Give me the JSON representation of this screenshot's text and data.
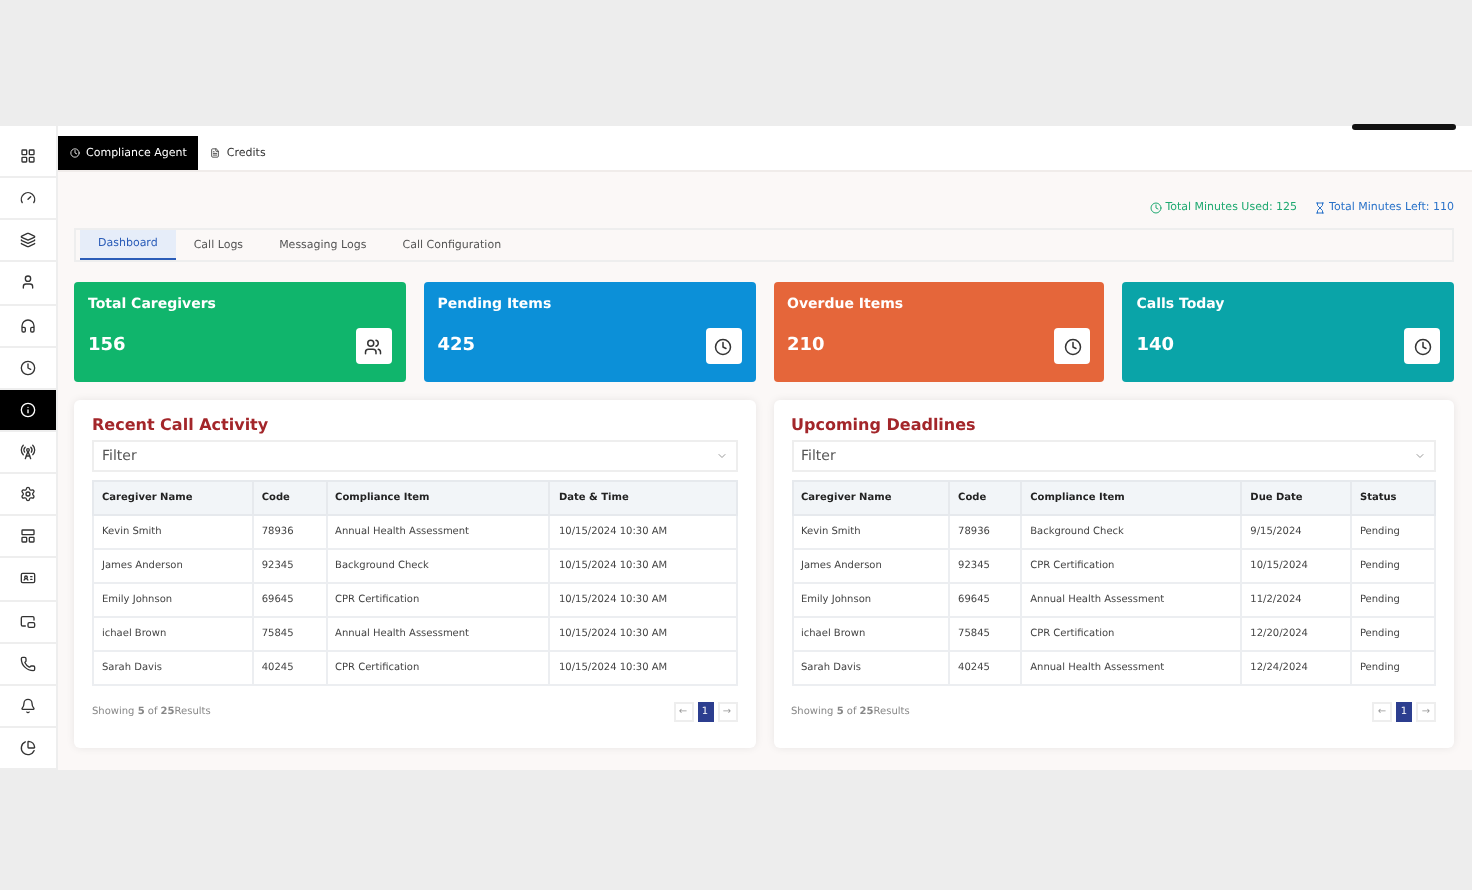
{
  "sidebar": {
    "items": [
      {
        "selected": false
      },
      {
        "selected": false
      },
      {
        "selected": false
      },
      {
        "selected": false
      },
      {
        "selected": false
      },
      {
        "selected": false
      },
      {
        "selected": true
      },
      {
        "selected": false
      },
      {
        "selected": false
      },
      {
        "selected": false
      },
      {
        "selected": false
      },
      {
        "selected": false
      },
      {
        "selected": false
      },
      {
        "selected": false
      },
      {
        "selected": false
      }
    ]
  },
  "top_tabs": [
    {
      "label": "Compliance Agent",
      "selected": true
    },
    {
      "label": "Credits",
      "selected": false
    }
  ],
  "minutes": [
    {
      "label": "Total Minutes Used: 125",
      "color": "#1fa971"
    },
    {
      "label": "Total Minutes Left: 110",
      "color": "#2a73c9"
    }
  ],
  "tabs": [
    {
      "label": "Dashboard",
      "selected": true
    },
    {
      "label": "Call Logs",
      "selected": false
    },
    {
      "label": "Messaging Logs",
      "selected": false
    },
    {
      "label": "Call Configuration",
      "selected": false
    }
  ],
  "cards": [
    {
      "title": "Total Caregivers",
      "value": "156",
      "color": "#10b56c"
    },
    {
      "title": "Pending Items",
      "value": "425",
      "color": "#0c90d8"
    },
    {
      "title": "Overdue Items",
      "value": "210",
      "color": "#e5663a"
    },
    {
      "title": "Calls Today",
      "value": "140",
      "color": "#0aa4a8"
    }
  ],
  "panels": [
    {
      "title": "Recent Call Activity",
      "filter": {
        "placeholder": "Filter"
      },
      "columns": [
        "Caregiver Name",
        "Code",
        "Compliance Item",
        "Date & Time"
      ],
      "rows": [
        [
          "Kevin Smith",
          "78936",
          "Annual Health Assessment",
          "10/15/2024 10:30 AM"
        ],
        [
          "James Anderson",
          "92345",
          "Background Check",
          "10/15/2024 10:30 AM"
        ],
        [
          "Emily Johnson",
          "69645",
          "CPR Certification",
          "10/15/2024 10:30 AM"
        ],
        [
          "ichael Brown",
          "75845",
          "Annual Health Assessment",
          "10/15/2024 10:30 AM"
        ],
        [
          "Sarah Davis",
          "40245",
          "CPR Certification",
          "10/15/2024 10:30 AM"
        ]
      ],
      "footer": "Showing **5** of **25**Results",
      "prev": "←",
      "next": "→",
      "pages": [
        {
          "label": "1",
          "selected": true
        }
      ]
    },
    {
      "title": "Upcoming Deadlines",
      "filter": {
        "placeholder": "Filter"
      },
      "columns": [
        "Caregiver Name",
        "Code",
        "Compliance Item",
        "Due Date",
        "Status"
      ],
      "rows": [
        [
          "Kevin Smith",
          "78936",
          "Background Check",
          "9/15/2024",
          "Pending"
        ],
        [
          "James Anderson",
          "92345",
          "CPR Certification",
          "10/15/2024",
          "Pending"
        ],
        [
          "Emily Johnson",
          "69645",
          "Annual Health Assessment",
          "11/2/2024",
          "Pending"
        ],
        [
          "ichael Brown",
          "75845",
          "CPR Certification",
          "12/20/2024",
          "Pending"
        ],
        [
          "Sarah Davis",
          "40245",
          "Annual Health Assessment",
          "12/24/2024",
          "Pending"
        ]
      ],
      "footer": "Showing **5** of **25**Results",
      "prev": "←",
      "next": "→",
      "pages": [
        {
          "label": "1",
          "selected": true
        }
      ]
    }
  ]
}
